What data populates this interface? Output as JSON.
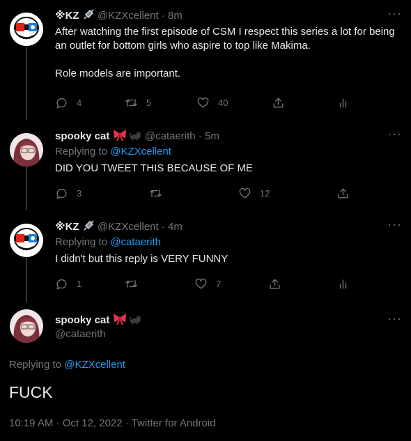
{
  "tweets": [
    {
      "name": "※KZ",
      "badge_icon": "syringe-icon",
      "handle": "@KZXcellent",
      "separator": "·",
      "time": "8m",
      "text": "After watching the first episode of CSM I respect this series a lot for being an outlet for bottom girls who aspire to top like Makima.\n\nRole models are important.",
      "stats": {
        "replies": "4",
        "retweets": "5",
        "likes": "40"
      }
    },
    {
      "name": "spooky cat",
      "badge_icons": [
        "ribbon-icon",
        "black-cat-icon"
      ],
      "handle": "@cataerith",
      "separator": "·",
      "time": "5m",
      "replying_prefix": "Replying to",
      "replying_to": "@KZXcellent",
      "text": "DID YOU TWEET THIS BECAUSE OF ME",
      "stats": {
        "replies": "3",
        "retweets": "",
        "likes": "12"
      }
    },
    {
      "name": "※KZ",
      "badge_icon": "syringe-icon",
      "handle": "@KZXcellent",
      "separator": "·",
      "time": "4m",
      "replying_prefix": "Replying to",
      "replying_to": "@cataerith",
      "text": "I didn't but this reply is VERY FUNNY",
      "stats": {
        "replies": "1",
        "retweets": "",
        "likes": "7"
      }
    }
  ],
  "focused": {
    "name": "spooky cat",
    "badge_icons": [
      "ribbon-icon",
      "black-cat-icon"
    ],
    "handle": "@cataerith",
    "replying_prefix": "Replying to",
    "replying_to": "@KZXcellent",
    "text": "FUCK",
    "meta": "10:19 AM · Oct 12, 2022 · Twitter for Android"
  },
  "colors": {
    "background": "#000000",
    "text": "#e7e9ea",
    "muted": "#71767b",
    "link": "#1d9bf0",
    "thread_line": "#333639"
  }
}
